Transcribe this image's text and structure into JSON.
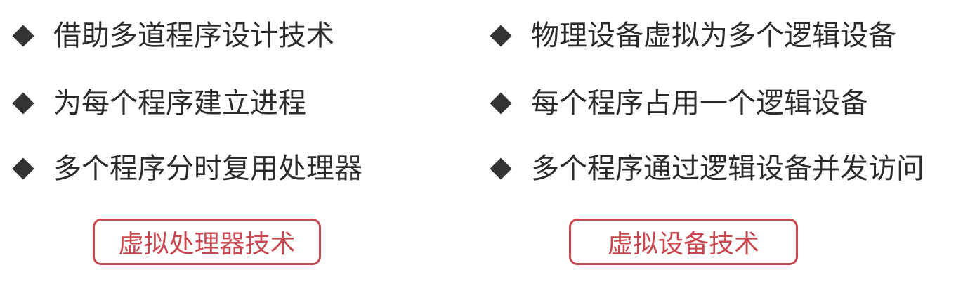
{
  "left": {
    "items": [
      {
        "text": "借助多道程序设计技术"
      },
      {
        "text": "为每个程序建立进程"
      },
      {
        "text": "多个程序分时复用处理器"
      }
    ],
    "tag": "虚拟处理器技术"
  },
  "right": {
    "items": [
      {
        "text": "物理设备虚拟为多个逻辑设备"
      },
      {
        "text": "每个程序占用一个逻辑设备"
      },
      {
        "text": "多个程序通过逻辑设备并发访问"
      }
    ],
    "tag": "虚拟设备技术"
  },
  "colors": {
    "accent": "#c9474f",
    "bullet": "#333333",
    "text": "#2b2b2b"
  },
  "icons": {
    "bullet": "diamond-bullet-icon"
  }
}
